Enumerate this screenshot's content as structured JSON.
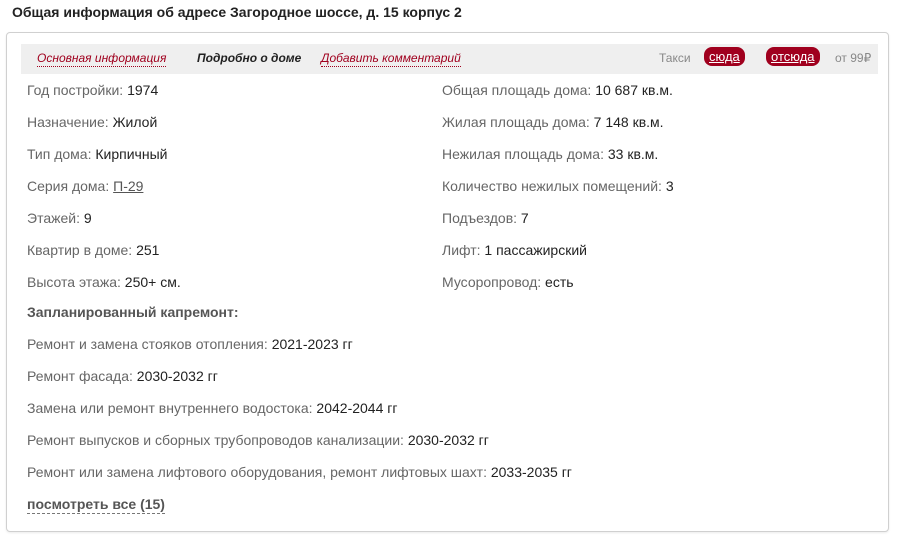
{
  "page_title": "Общая информация об адресе Загородное шоссе, д. 15 корпус 2",
  "tabs": {
    "main_info": "Основная информация",
    "details": "Подробно о доме",
    "add_comment": "Добавить комментарий"
  },
  "taxi": {
    "label": "Такси",
    "to_here": "сюда",
    "from_here": "отсюда",
    "price": "от 99₽"
  },
  "left_col": [
    {
      "label": "Год постройки:",
      "value": "1974"
    },
    {
      "label": "Назначение:",
      "value": "Жилой"
    },
    {
      "label": "Тип дома:",
      "value": "Кирпичный"
    },
    {
      "label": "Серия дома:",
      "value": "П-29"
    },
    {
      "label": "Этажей:",
      "value": "9"
    },
    {
      "label": "Квартир в доме:",
      "value": "251"
    },
    {
      "label": "Высота этажа:",
      "value": "250+ см."
    }
  ],
  "right_col": [
    {
      "label": "Общая площадь дома:",
      "value": "10 687 кв.м."
    },
    {
      "label": "Жилая площадь дома:",
      "value": "7 148 кв.м."
    },
    {
      "label": "Нежилая площадь дома:",
      "value": "33 кв.м."
    },
    {
      "label": "Количество нежилых помещений:",
      "value": "3"
    },
    {
      "label": "Подъездов:",
      "value": "7"
    },
    {
      "label": "Лифт:",
      "value": "1 пассажирский"
    },
    {
      "label": "Мусоропровод:",
      "value": "есть"
    }
  ],
  "repairs": {
    "title": "Запланированный капремонт:",
    "items": [
      {
        "label": "Ремонт и замена стояков отопления:",
        "value": "2021-2023 гг"
      },
      {
        "label": "Ремонт фасада:",
        "value": "2030-2032 гг"
      },
      {
        "label": "Замена или ремонт внутреннего водостока:",
        "value": "2042-2044 гг"
      },
      {
        "label": "Ремонт выпусков и сборных трубопроводов канализации:",
        "value": "2030-2032 гг"
      },
      {
        "label": "Ремонт или замена лифтового оборудования, ремонт лифтовых шахт:",
        "value": "2033-2035 гг"
      }
    ],
    "show_all": "посмотреть все (15)"
  }
}
